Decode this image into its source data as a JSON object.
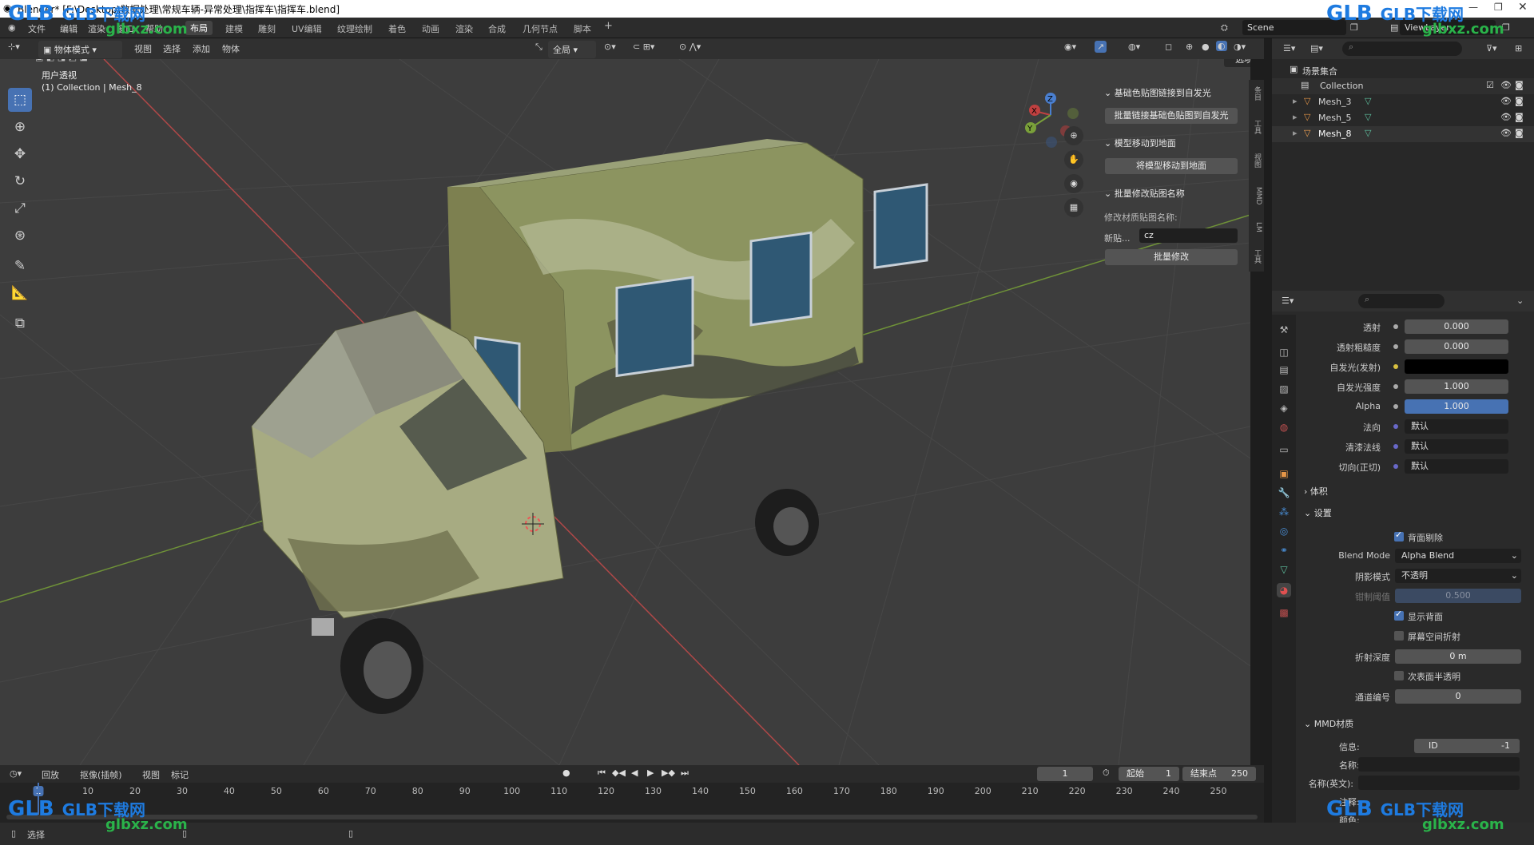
{
  "titlebar": {
    "text": "Blender* [F:\\Desktop\\数据处理\\常规车辆-异常处理\\指挥车\\指挥车.blend]"
  },
  "menu": [
    "文件",
    "编辑",
    "渲染",
    "窗口",
    "帮助"
  ],
  "workspaces": [
    "布局",
    "建模",
    "雕刻",
    "UV编辑",
    "纹理绘制",
    "着色",
    "动画",
    "渲染",
    "合成",
    "几何节点",
    "脚本"
  ],
  "workspace_add": "+",
  "scene": {
    "name": "Scene",
    "view_layer": "ViewLayer"
  },
  "viewport_header": {
    "mode": "物体模式",
    "menus": [
      "视图",
      "选择",
      "添加",
      "物体"
    ],
    "orientation": "全局",
    "options_label": "选项"
  },
  "viewport": {
    "view_name": "用户透视",
    "collection_info": "(1) Collection | Mesh_8"
  },
  "gizmo": {
    "x": "X",
    "y": "Y",
    "z": "Z"
  },
  "npanel": {
    "section1_title": "基础色贴图链接到自发光",
    "section1_button": "批量链接基础色贴图到自发光",
    "section2_title": "模型移动到地面",
    "section2_button": "将模型移动到地面",
    "section3_title": "批量修改贴图名称",
    "rename_label": "修改材质贴图名称:",
    "new_label": "新贴...",
    "new_value": "cz",
    "apply_button": "批量修改",
    "tabs": [
      "条目",
      "工具",
      "视图",
      "MMD",
      "LM",
      "工具"
    ]
  },
  "outliner": {
    "root": "场景集合",
    "collection": "Collection",
    "items": [
      "Mesh_3",
      "Mesh_5",
      "Mesh_8"
    ]
  },
  "properties": {
    "rows": [
      {
        "label": "透射",
        "value": "0.000"
      },
      {
        "label": "透射粗糙度",
        "value": "0.000"
      },
      {
        "label": "自发光(发射)",
        "value": ""
      },
      {
        "label": "自发光强度",
        "value": "1.000"
      },
      {
        "label": "Alpha",
        "value": "1.000"
      },
      {
        "label": "法向",
        "value": "默认"
      },
      {
        "label": "清漆法线",
        "value": "默认"
      },
      {
        "label": "切向(正切)",
        "value": "默认"
      }
    ],
    "volume_section": "体积",
    "settings_section": "设置",
    "backface_culling": "背面剔除",
    "blend_mode_label": "Blend Mode",
    "blend_mode_value": "Alpha Blend",
    "shadow_mode_label": "阴影模式",
    "shadow_mode_value": "不透明",
    "clip_label": "钳制阈值",
    "clip_value": "0.500",
    "show_backface": "显示背面",
    "ssr": "屏幕空间折射",
    "refraction_depth_label": "折射深度",
    "refraction_depth_value": "0 m",
    "subsurface": "次表面半透明",
    "pass_index_label": "通道编号",
    "pass_index_value": "0",
    "mmd_section": "MMD材质",
    "info_label": "信息:",
    "id_label": "ID",
    "id_value": "-1",
    "name_label": "名称:",
    "name_en_label": "名称(英文):",
    "note_label": "注释:",
    "color_label": "颜色:"
  },
  "timeline": {
    "menus": [
      "回放",
      "抠像(插帧)",
      "视图",
      "标记"
    ],
    "current_frame": "1",
    "start_label": "起始",
    "start_value": "1",
    "end_label": "结束点",
    "end_value": "250",
    "ticks": [
      "1",
      "10",
      "20",
      "30",
      "40",
      "50",
      "60",
      "70",
      "80",
      "90",
      "100",
      "110",
      "120",
      "130",
      "140",
      "150",
      "160",
      "170",
      "180",
      "190",
      "200",
      "210",
      "220",
      "230",
      "240",
      "250"
    ]
  },
  "statusbar": {
    "left": "选择"
  },
  "watermark": {
    "brand": "GLB下载网",
    "site": "glbxz.com",
    "logo": "GLB"
  },
  "colors": {
    "accent": "#4772b3",
    "viewport_bg": "#3d3d3d",
    "x_axis": "#c04040",
    "y_axis": "#7aa03a",
    "camo_base": "#8c9460"
  }
}
